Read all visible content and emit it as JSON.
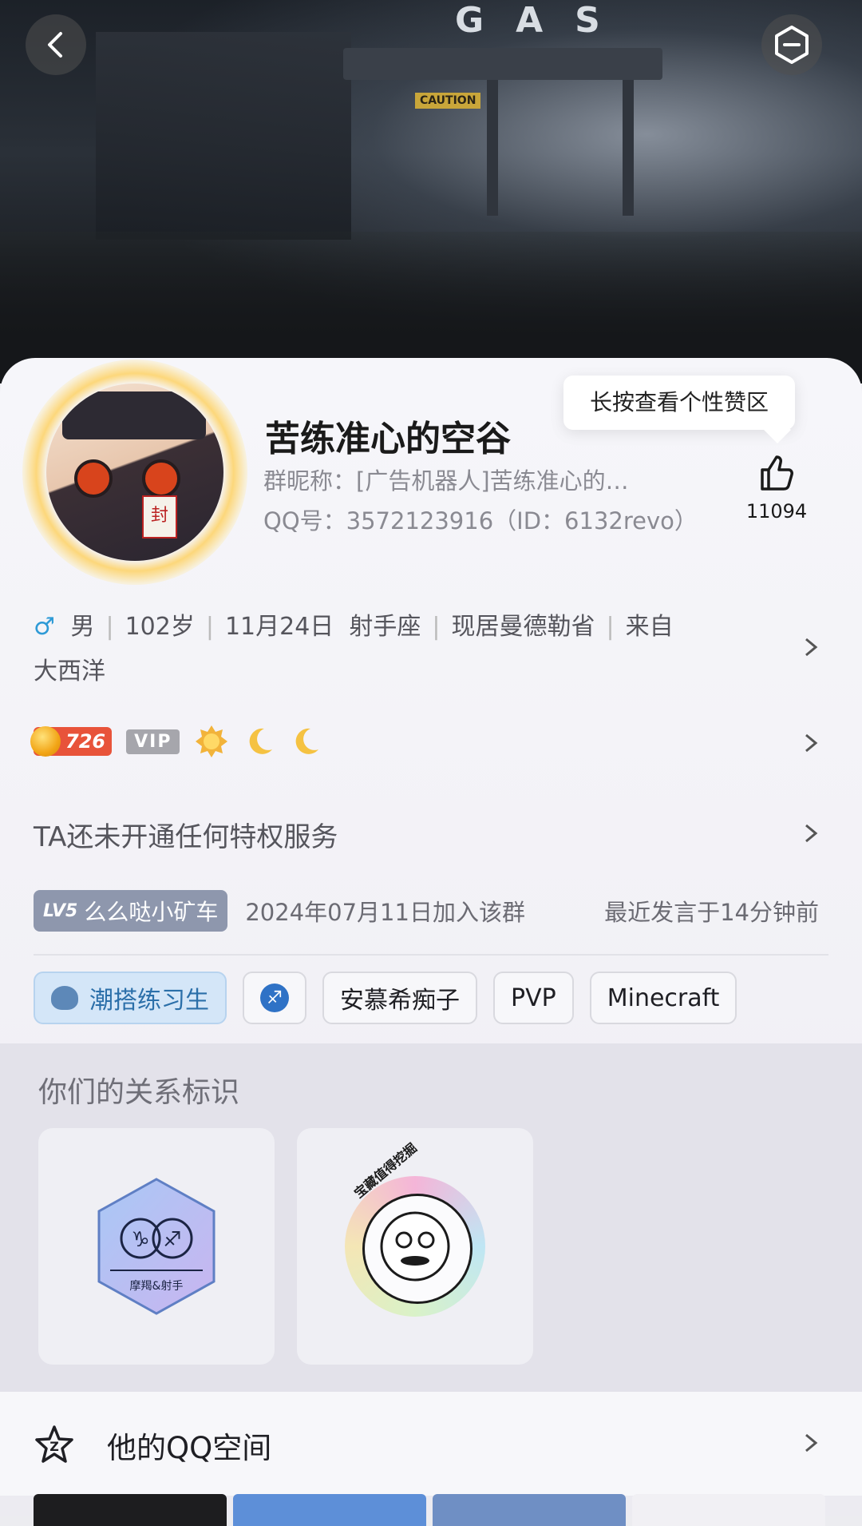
{
  "header": {
    "back_icon": "back-arrow-icon",
    "more_icon": "minus-hexagon-icon",
    "background_sign": "GAS",
    "background_caution": "CAUTION"
  },
  "profile": {
    "name": "苦练准心的空谷",
    "group_nickname": "群昵称：[广告机器人]苦练准心的…",
    "qq_line": "QQ号：3572123916（ID：6132revo）",
    "avatar_stamp": "封"
  },
  "likes": {
    "tooltip": "长按查看个性赞区",
    "count": "11094"
  },
  "info": {
    "gender": "男",
    "age": "102岁",
    "birthday": "11月24日",
    "zodiac": "射手座",
    "residence": "现居曼德勒省",
    "from": "来自",
    "origin": "大西洋"
  },
  "badges": {
    "coin_level": "726",
    "vip": "VIP",
    "icons": [
      "sun-icon",
      "moon-icon",
      "moon-icon"
    ]
  },
  "privilege": "TA还未开通任何特权服务",
  "group": {
    "level": "LV5",
    "title": "么么哒小矿车",
    "joined": "2024年07月11日加入该群",
    "recent": "最近发言于14分钟前"
  },
  "tags": [
    "潮搭练习生",
    "安慕希痴子",
    "PVP",
    "Minecraft"
  ],
  "relation": {
    "title": "你们的关系标识",
    "badge1_label": "摩羯&射手",
    "badge2_label": "宝藏值得挖掘"
  },
  "space": {
    "label": "他的QQ空间"
  },
  "colors": {
    "accent_blue": "#2e9ad6",
    "coin_red": "#e8533a",
    "tag_blue_bg": "#d4e6f8"
  }
}
